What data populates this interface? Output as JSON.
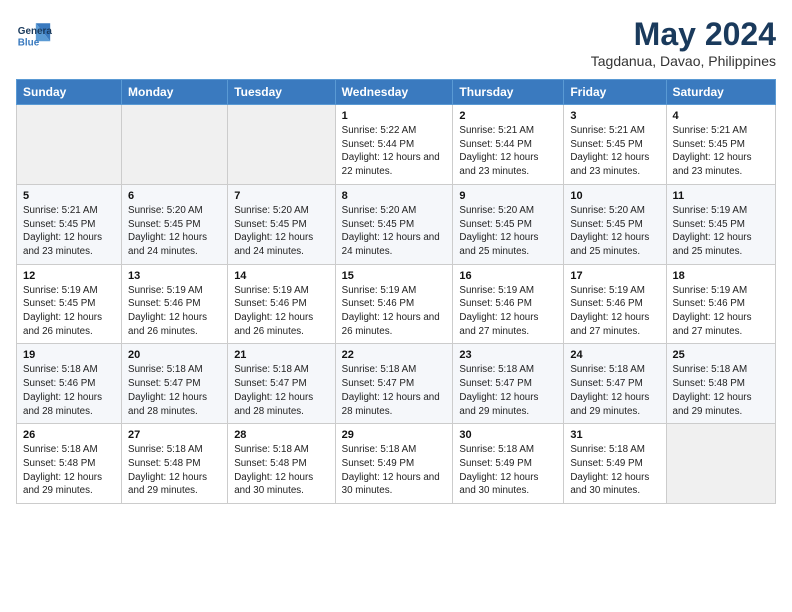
{
  "logo": {
    "line1": "General",
    "line2": "Blue"
  },
  "title": "May 2024",
  "subtitle": "Tagdanua, Davao, Philippines",
  "days_of_week": [
    "Sunday",
    "Monday",
    "Tuesday",
    "Wednesday",
    "Thursday",
    "Friday",
    "Saturday"
  ],
  "weeks": [
    [
      {
        "day": "",
        "sunrise": "",
        "sunset": "",
        "daylight": ""
      },
      {
        "day": "",
        "sunrise": "",
        "sunset": "",
        "daylight": ""
      },
      {
        "day": "",
        "sunrise": "",
        "sunset": "",
        "daylight": ""
      },
      {
        "day": "1",
        "sunrise": "5:22 AM",
        "sunset": "5:44 PM",
        "daylight": "12 hours and 22 minutes."
      },
      {
        "day": "2",
        "sunrise": "5:21 AM",
        "sunset": "5:44 PM",
        "daylight": "12 hours and 23 minutes."
      },
      {
        "day": "3",
        "sunrise": "5:21 AM",
        "sunset": "5:45 PM",
        "daylight": "12 hours and 23 minutes."
      },
      {
        "day": "4",
        "sunrise": "5:21 AM",
        "sunset": "5:45 PM",
        "daylight": "12 hours and 23 minutes."
      }
    ],
    [
      {
        "day": "5",
        "sunrise": "5:21 AM",
        "sunset": "5:45 PM",
        "daylight": "12 hours and 23 minutes."
      },
      {
        "day": "6",
        "sunrise": "5:20 AM",
        "sunset": "5:45 PM",
        "daylight": "12 hours and 24 minutes."
      },
      {
        "day": "7",
        "sunrise": "5:20 AM",
        "sunset": "5:45 PM",
        "daylight": "12 hours and 24 minutes."
      },
      {
        "day": "8",
        "sunrise": "5:20 AM",
        "sunset": "5:45 PM",
        "daylight": "12 hours and 24 minutes."
      },
      {
        "day": "9",
        "sunrise": "5:20 AM",
        "sunset": "5:45 PM",
        "daylight": "12 hours and 25 minutes."
      },
      {
        "day": "10",
        "sunrise": "5:20 AM",
        "sunset": "5:45 PM",
        "daylight": "12 hours and 25 minutes."
      },
      {
        "day": "11",
        "sunrise": "5:19 AM",
        "sunset": "5:45 PM",
        "daylight": "12 hours and 25 minutes."
      }
    ],
    [
      {
        "day": "12",
        "sunrise": "5:19 AM",
        "sunset": "5:45 PM",
        "daylight": "12 hours and 26 minutes."
      },
      {
        "day": "13",
        "sunrise": "5:19 AM",
        "sunset": "5:46 PM",
        "daylight": "12 hours and 26 minutes."
      },
      {
        "day": "14",
        "sunrise": "5:19 AM",
        "sunset": "5:46 PM",
        "daylight": "12 hours and 26 minutes."
      },
      {
        "day": "15",
        "sunrise": "5:19 AM",
        "sunset": "5:46 PM",
        "daylight": "12 hours and 26 minutes."
      },
      {
        "day": "16",
        "sunrise": "5:19 AM",
        "sunset": "5:46 PM",
        "daylight": "12 hours and 27 minutes."
      },
      {
        "day": "17",
        "sunrise": "5:19 AM",
        "sunset": "5:46 PM",
        "daylight": "12 hours and 27 minutes."
      },
      {
        "day": "18",
        "sunrise": "5:19 AM",
        "sunset": "5:46 PM",
        "daylight": "12 hours and 27 minutes."
      }
    ],
    [
      {
        "day": "19",
        "sunrise": "5:18 AM",
        "sunset": "5:46 PM",
        "daylight": "12 hours and 28 minutes."
      },
      {
        "day": "20",
        "sunrise": "5:18 AM",
        "sunset": "5:47 PM",
        "daylight": "12 hours and 28 minutes."
      },
      {
        "day": "21",
        "sunrise": "5:18 AM",
        "sunset": "5:47 PM",
        "daylight": "12 hours and 28 minutes."
      },
      {
        "day": "22",
        "sunrise": "5:18 AM",
        "sunset": "5:47 PM",
        "daylight": "12 hours and 28 minutes."
      },
      {
        "day": "23",
        "sunrise": "5:18 AM",
        "sunset": "5:47 PM",
        "daylight": "12 hours and 29 minutes."
      },
      {
        "day": "24",
        "sunrise": "5:18 AM",
        "sunset": "5:47 PM",
        "daylight": "12 hours and 29 minutes."
      },
      {
        "day": "25",
        "sunrise": "5:18 AM",
        "sunset": "5:48 PM",
        "daylight": "12 hours and 29 minutes."
      }
    ],
    [
      {
        "day": "26",
        "sunrise": "5:18 AM",
        "sunset": "5:48 PM",
        "daylight": "12 hours and 29 minutes."
      },
      {
        "day": "27",
        "sunrise": "5:18 AM",
        "sunset": "5:48 PM",
        "daylight": "12 hours and 29 minutes."
      },
      {
        "day": "28",
        "sunrise": "5:18 AM",
        "sunset": "5:48 PM",
        "daylight": "12 hours and 30 minutes."
      },
      {
        "day": "29",
        "sunrise": "5:18 AM",
        "sunset": "5:49 PM",
        "daylight": "12 hours and 30 minutes."
      },
      {
        "day": "30",
        "sunrise": "5:18 AM",
        "sunset": "5:49 PM",
        "daylight": "12 hours and 30 minutes."
      },
      {
        "day": "31",
        "sunrise": "5:18 AM",
        "sunset": "5:49 PM",
        "daylight": "12 hours and 30 minutes."
      },
      {
        "day": "",
        "sunrise": "",
        "sunset": "",
        "daylight": ""
      }
    ]
  ]
}
